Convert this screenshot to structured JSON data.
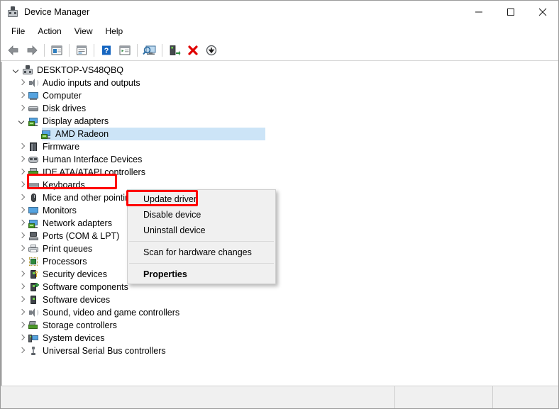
{
  "window": {
    "title": "Device Manager",
    "icon": "device-manager-icon",
    "caption_buttons": [
      {
        "name": "minimize-button",
        "glyph": "minimize"
      },
      {
        "name": "maximize-button",
        "glyph": "maximize"
      },
      {
        "name": "close-button",
        "glyph": "close"
      }
    ]
  },
  "menubar": {
    "items": [
      {
        "label": "File"
      },
      {
        "label": "Action"
      },
      {
        "label": "View"
      },
      {
        "label": "Help"
      }
    ]
  },
  "toolbar": {
    "buttons": [
      {
        "name": "back-button",
        "icon": "back-arrow-icon"
      },
      {
        "name": "forward-button",
        "icon": "forward-arrow-icon"
      },
      {
        "name": "separator-1",
        "icon": "separator"
      },
      {
        "name": "show-hide-console-tree-button",
        "icon": "console-tree-icon"
      },
      {
        "name": "separator-2",
        "icon": "separator"
      },
      {
        "name": "properties-button",
        "icon": "properties-window-icon"
      },
      {
        "name": "separator-3",
        "icon": "separator"
      },
      {
        "name": "help-button",
        "icon": "help-question-icon"
      },
      {
        "name": "show-window-button",
        "icon": "window-list-icon"
      },
      {
        "name": "separator-4",
        "icon": "separator"
      },
      {
        "name": "scan-for-hardware-changes-button",
        "icon": "scan-monitor-icon"
      },
      {
        "name": "separator-5",
        "icon": "separator"
      },
      {
        "name": "update-driver-button",
        "icon": "update-driver-icon"
      },
      {
        "name": "uninstall-device-button",
        "icon": "red-x-icon"
      },
      {
        "name": "disable-device-button",
        "icon": "down-arrow-circle-icon"
      }
    ]
  },
  "tree": {
    "root": {
      "label": "DESKTOP-VS48QBQ",
      "icon": "computer-root-icon",
      "expanded": true
    },
    "nodes": [
      {
        "label": "Audio inputs and outputs",
        "icon": "speaker-icon",
        "expanded": false,
        "level": 1
      },
      {
        "label": "Computer",
        "icon": "computer-icon",
        "expanded": false,
        "level": 1
      },
      {
        "label": "Disk drives",
        "icon": "disk-drive-icon",
        "expanded": false,
        "level": 1
      },
      {
        "label": "Display adapters",
        "icon": "display-adapter-icon",
        "expanded": true,
        "level": 1,
        "highlighted": true
      },
      {
        "label": "AMD Radeon",
        "icon": "display-adapter-icon",
        "expanded": null,
        "level": 2,
        "selected": true
      },
      {
        "label": "Firmware",
        "icon": "firmware-icon",
        "expanded": false,
        "level": 1
      },
      {
        "label": "Human Interface Devices",
        "icon": "hid-icon",
        "expanded": false,
        "level": 1
      },
      {
        "label": "IDE ATA/ATAPI controllers",
        "icon": "ide-controller-icon",
        "expanded": false,
        "level": 1
      },
      {
        "label": "Keyboards",
        "icon": "keyboard-icon",
        "expanded": false,
        "level": 1
      },
      {
        "label": "Mice and other pointing devices",
        "icon": "mouse-icon",
        "expanded": false,
        "level": 1
      },
      {
        "label": "Monitors",
        "icon": "monitor-icon",
        "expanded": false,
        "level": 1
      },
      {
        "label": "Network adapters",
        "icon": "network-adapter-icon",
        "expanded": false,
        "level": 1
      },
      {
        "label": "Ports (COM & LPT)",
        "icon": "port-icon",
        "expanded": false,
        "level": 1
      },
      {
        "label": "Print queues",
        "icon": "printer-icon",
        "expanded": false,
        "level": 1
      },
      {
        "label": "Processors",
        "icon": "processor-icon",
        "expanded": false,
        "level": 1
      },
      {
        "label": "Security devices",
        "icon": "security-device-icon",
        "expanded": false,
        "level": 1
      },
      {
        "label": "Software components",
        "icon": "software-component-icon",
        "expanded": false,
        "level": 1
      },
      {
        "label": "Software devices",
        "icon": "software-device-icon",
        "expanded": false,
        "level": 1
      },
      {
        "label": "Sound, video and game controllers",
        "icon": "speaker-icon",
        "expanded": false,
        "level": 1
      },
      {
        "label": "Storage controllers",
        "icon": "storage-controller-icon",
        "expanded": false,
        "level": 1
      },
      {
        "label": "System devices",
        "icon": "system-device-icon",
        "expanded": false,
        "level": 1
      },
      {
        "label": "Universal Serial Bus controllers",
        "icon": "usb-controller-icon",
        "expanded": false,
        "level": 1
      }
    ]
  },
  "context_menu": {
    "items": [
      {
        "label": "Update driver",
        "bold": false,
        "highlighted": true
      },
      {
        "label": "Disable device",
        "bold": false
      },
      {
        "label": "Uninstall device",
        "bold": false
      },
      {
        "separator": true
      },
      {
        "label": "Scan for hardware changes",
        "bold": false
      },
      {
        "separator": true
      },
      {
        "label": "Properties",
        "bold": true
      }
    ]
  },
  "annotations": [
    {
      "name": "redbox-display-adapters",
      "target": "Display adapters",
      "color": "#ff0000"
    },
    {
      "name": "redbox-update-driver",
      "target": "Update driver",
      "color": "#ff0000"
    }
  ],
  "statusbar": {
    "panels": [
      "",
      "",
      ""
    ]
  },
  "colors": {
    "selection": "#cce4f7",
    "annotation": "#ff0000",
    "menu_bg": "#f0f0f0",
    "window_bg": "#ffffff"
  }
}
